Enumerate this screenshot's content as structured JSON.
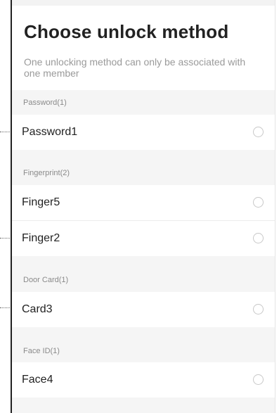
{
  "title": "Choose unlock method",
  "subtitle": "One unlocking method can only be associated with one member",
  "sections": [
    {
      "label": "Password(1)",
      "items": [
        "Password1"
      ]
    },
    {
      "label": "Fingerprint(2)",
      "items": [
        "Finger5",
        "Finger2"
      ]
    },
    {
      "label": "Door Card(1)",
      "items": [
        "Card3"
      ]
    },
    {
      "label": "Face ID(1)",
      "items": [
        "Face4"
      ]
    }
  ],
  "colors": {
    "background": "#ffffff",
    "section_background": "#f5f5f5",
    "title_text": "#222222",
    "secondary_text": "#9a9a9a",
    "radio_border": "#c8c8c8"
  },
  "icons": {
    "radio": "radio-unselected-icon"
  }
}
